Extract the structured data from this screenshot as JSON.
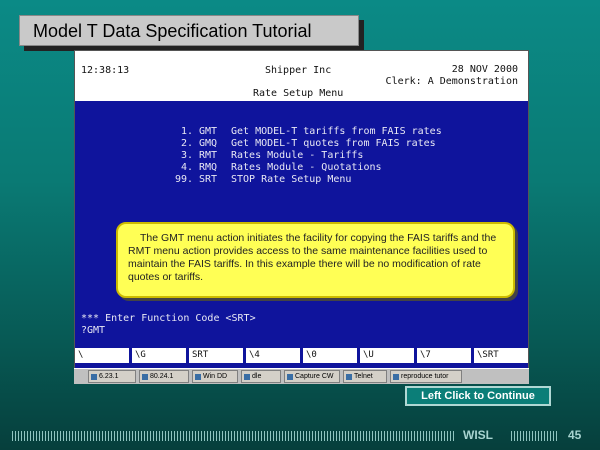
{
  "slide": {
    "title": "Model T Data Specification Tutorial",
    "continue_label": "Left Click to Continue",
    "footer_label": "WISL",
    "page_number": "45"
  },
  "terminal": {
    "time": "12:38:13",
    "company": "Shipper Inc",
    "date": "28 NOV 2000",
    "clerk": "Clerk: A Demonstration",
    "menu_title": "Rate Setup Menu",
    "menu_items": [
      {
        "num": "1.",
        "code": "GMT",
        "desc": "Get MODEL-T tariffs from FAIS rates"
      },
      {
        "num": "2.",
        "code": "GMQ",
        "desc": "Get MODEL-T quotes from FAIS rates"
      },
      {
        "num": "3.",
        "code": "RMT",
        "desc": "Rates Module - Tariffs"
      },
      {
        "num": "4.",
        "code": "RMQ",
        "desc": "Rates Module - Quotations"
      },
      {
        "num": "99.",
        "code": "SRT",
        "desc": "STOP Rate Setup Menu"
      }
    ],
    "prompt": "*** Enter Function Code <SRT>",
    "input": "?GMT",
    "function_keys": [
      "\\",
      "\\G",
      "SRT",
      "\\4",
      "\\0",
      "\\U",
      "\\7",
      "\\SRT"
    ]
  },
  "callout": {
    "text": "The GMT menu action initiates the facility for copying the FAIS tariffs and the RMT menu action provides access to the same maintenance facilities used to maintain the FAIS tariffs. In this example there will be no modification of rate quotes or tariffs."
  },
  "taskbar": {
    "items": [
      "6.23.1",
      "80.24.1",
      "Win DD",
      "dle",
      "Capture CW",
      "Telnet",
      "reproduce tutor"
    ]
  }
}
